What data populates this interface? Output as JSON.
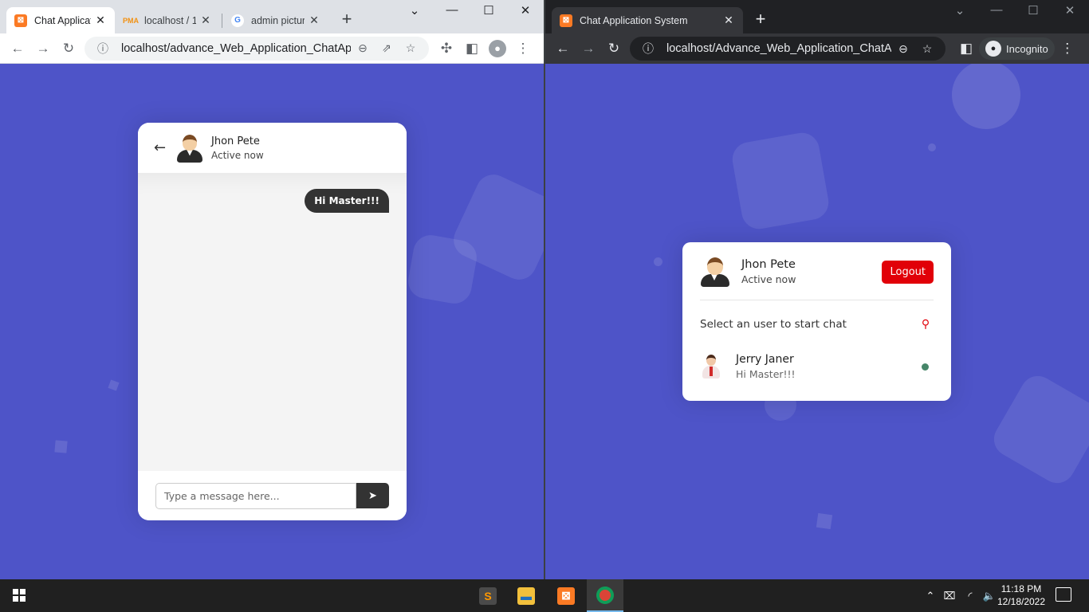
{
  "left_window": {
    "tabs": [
      {
        "title": "Chat Applicati",
        "favicon": "xampp-icon",
        "active": true
      },
      {
        "title": "localhost / 12",
        "favicon": "phpmyadmin-icon",
        "active": false
      },
      {
        "title": "admin picture",
        "favicon": "google-icon",
        "active": false
      }
    ],
    "url": "localhost/advance_Web_Application_ChatApp/..."
  },
  "right_window": {
    "tabs": [
      {
        "title": "Chat Application System",
        "favicon": "xampp-icon",
        "active": true
      }
    ],
    "url": "localhost/Advance_Web_Application_ChatApp...",
    "incognito_label": "Incognito"
  },
  "chat": {
    "user_name": "Jhon Pete",
    "user_status": "Active now",
    "messages": [
      {
        "direction": "outgoing",
        "text": "Hi Master!!!"
      }
    ],
    "input_placeholder": "Type a message here..."
  },
  "users": {
    "current_user": {
      "name": "Jhon Pete",
      "status": "Active now"
    },
    "logout_label": "Logout",
    "search_label": "Select an user to start chat",
    "list": [
      {
        "name": "Jerry Janer",
        "last_message": "Hi Master!!!",
        "online": true
      }
    ]
  },
  "taskbar": {
    "apps": [
      "sublime-text-icon",
      "file-explorer-icon",
      "xampp-icon",
      "chrome-icon"
    ],
    "time": "11:18 PM",
    "date": "12/18/2022"
  },
  "colors": {
    "page_bg": "#4e54c8",
    "logout_red": "#e10008",
    "online_green": "#468669"
  }
}
